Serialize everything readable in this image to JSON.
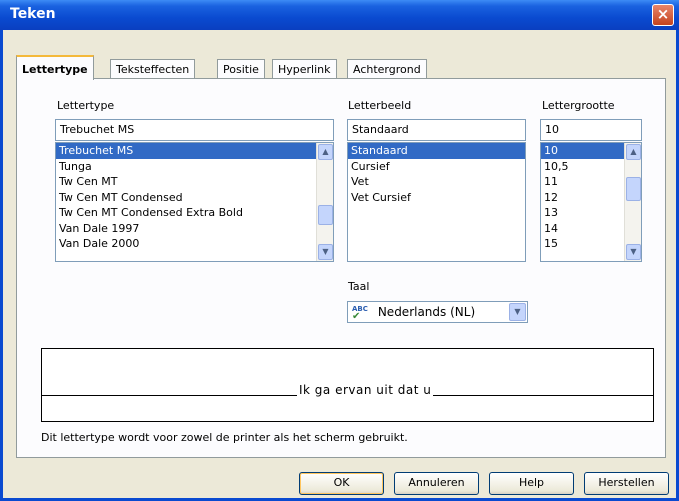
{
  "window": {
    "title": "Teken",
    "close_glyph": "×"
  },
  "tabs": [
    {
      "label": "Lettertype",
      "active": true
    },
    {
      "label": "Teksteffecten"
    },
    {
      "label": "Positie"
    },
    {
      "label": "Hyperlink"
    },
    {
      "label": "Achtergrond"
    }
  ],
  "font": {
    "label": "Lettertype",
    "value": "Trebuchet MS",
    "items": [
      "Trebuchet MS",
      "Tunga",
      "Tw Cen MT",
      "Tw Cen MT Condensed",
      "Tw Cen MT Condensed Extra Bold",
      "Van Dale 1997",
      "Van Dale 2000"
    ],
    "selected_index": 0
  },
  "style": {
    "label": "Letterbeeld",
    "value": "Standaard",
    "items": [
      "Standaard",
      "Cursief",
      "Vet",
      "Vet Cursief"
    ],
    "selected_index": 0
  },
  "size": {
    "label": "Lettergrootte",
    "value": "10",
    "items": [
      "10",
      "10,5",
      "11",
      "12",
      "13",
      "14",
      "15"
    ],
    "selected_index": 0
  },
  "language": {
    "label": "Taal",
    "value": "Nederlands (NL)",
    "icon": "spellcheck-icon",
    "icon_glyph": "ABC"
  },
  "preview": {
    "text": "Ik ga ervan uit dat u"
  },
  "info_text": "Dit lettertype wordt voor zowel de printer als het scherm gebruikt.",
  "buttons": {
    "ok": "OK",
    "cancel": "Annuleren",
    "help": "Help",
    "reset": "Herstellen"
  }
}
